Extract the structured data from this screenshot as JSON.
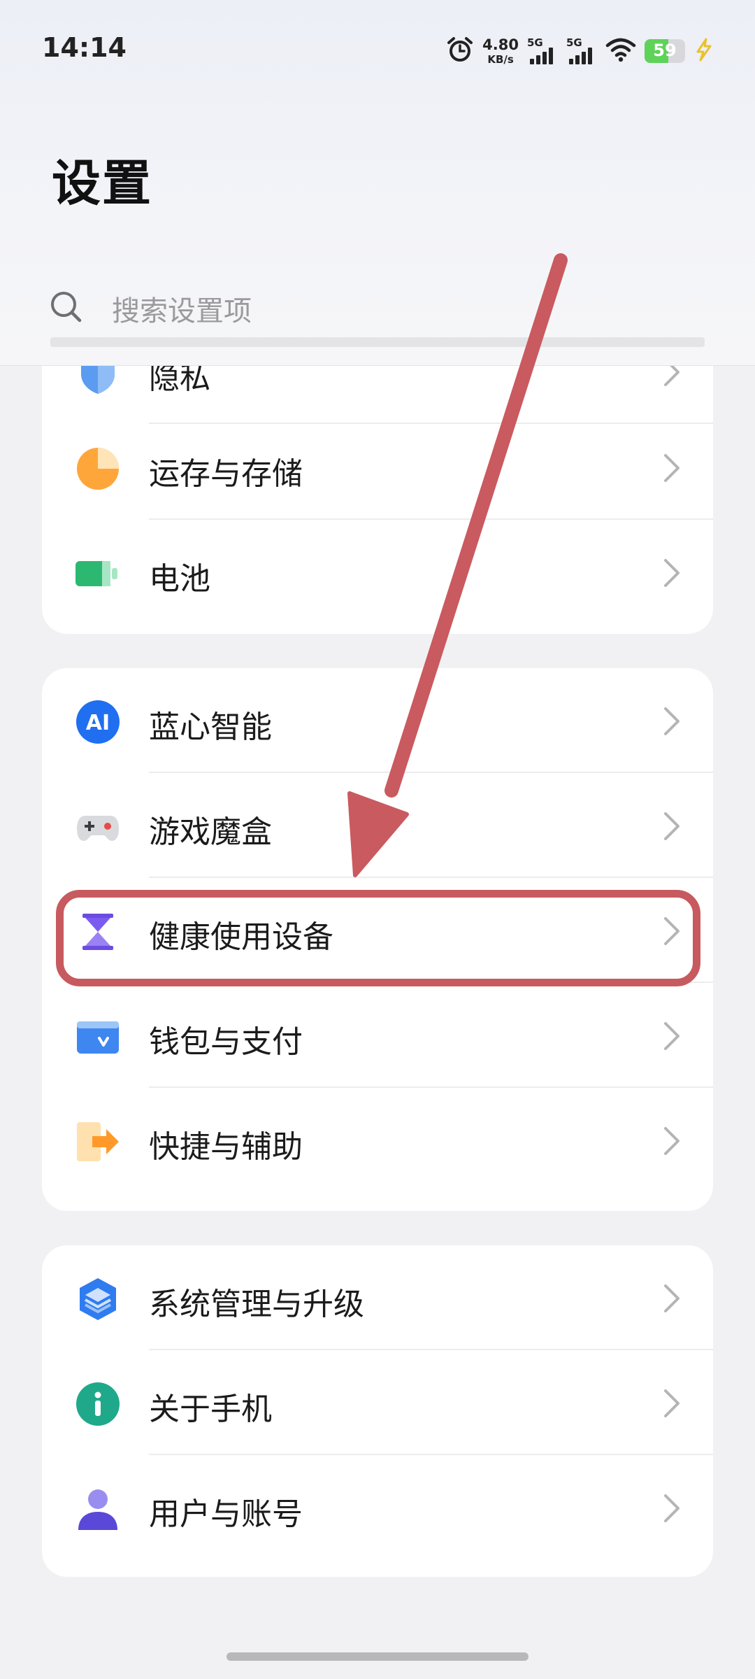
{
  "status_bar": {
    "time": "14:14",
    "net_speed_value": "4.80",
    "net_speed_unit": "KB/s",
    "signal1": "5G",
    "signal2": "5G",
    "battery": "59"
  },
  "header": {
    "title": "设置",
    "search_placeholder": "搜索设置项"
  },
  "card1": {
    "items": [
      {
        "label": "隐私"
      },
      {
        "label": "运存与存储"
      },
      {
        "label": "电池"
      }
    ]
  },
  "card2": {
    "items": [
      {
        "label": "蓝心智能"
      },
      {
        "label": "游戏魔盒"
      },
      {
        "label": "健康使用设备"
      },
      {
        "label": "钱包与支付"
      },
      {
        "label": "快捷与辅助"
      }
    ]
  },
  "card3": {
    "items": [
      {
        "label": "系统管理与升级"
      },
      {
        "label": "关于手机"
      },
      {
        "label": "用户与账号"
      }
    ]
  },
  "icons": {
    "ai_text": "AI"
  },
  "colors": {
    "highlight": "#c75a5f",
    "arrow": "#c95a5f",
    "battery_fill": "#5fd25a"
  }
}
